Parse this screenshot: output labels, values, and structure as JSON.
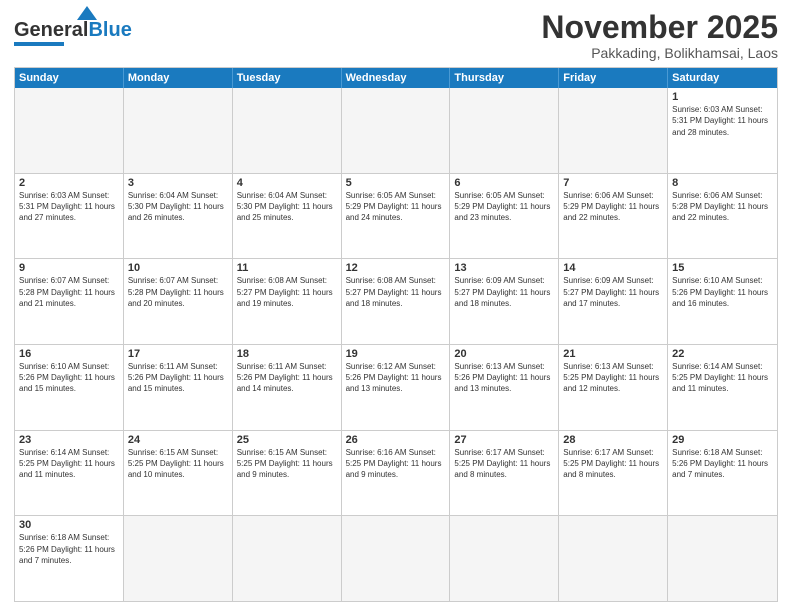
{
  "logo": {
    "text_general": "General",
    "text_blue": "Blue"
  },
  "title": "November 2025",
  "location": "Pakkading, Bolikhamsai, Laos",
  "header": {
    "days": [
      "Sunday",
      "Monday",
      "Tuesday",
      "Wednesday",
      "Thursday",
      "Friday",
      "Saturday"
    ]
  },
  "weeks": [
    [
      {
        "day": "",
        "empty": true,
        "info": ""
      },
      {
        "day": "",
        "empty": true,
        "info": ""
      },
      {
        "day": "",
        "empty": true,
        "info": ""
      },
      {
        "day": "",
        "empty": true,
        "info": ""
      },
      {
        "day": "",
        "empty": true,
        "info": ""
      },
      {
        "day": "",
        "empty": true,
        "info": ""
      },
      {
        "day": "1",
        "empty": false,
        "info": "Sunrise: 6:03 AM\nSunset: 5:31 PM\nDaylight: 11 hours\nand 28 minutes."
      }
    ],
    [
      {
        "day": "2",
        "empty": false,
        "info": "Sunrise: 6:03 AM\nSunset: 5:31 PM\nDaylight: 11 hours\nand 27 minutes."
      },
      {
        "day": "3",
        "empty": false,
        "info": "Sunrise: 6:04 AM\nSunset: 5:30 PM\nDaylight: 11 hours\nand 26 minutes."
      },
      {
        "day": "4",
        "empty": false,
        "info": "Sunrise: 6:04 AM\nSunset: 5:30 PM\nDaylight: 11 hours\nand 25 minutes."
      },
      {
        "day": "5",
        "empty": false,
        "info": "Sunrise: 6:05 AM\nSunset: 5:29 PM\nDaylight: 11 hours\nand 24 minutes."
      },
      {
        "day": "6",
        "empty": false,
        "info": "Sunrise: 6:05 AM\nSunset: 5:29 PM\nDaylight: 11 hours\nand 23 minutes."
      },
      {
        "day": "7",
        "empty": false,
        "info": "Sunrise: 6:06 AM\nSunset: 5:29 PM\nDaylight: 11 hours\nand 22 minutes."
      },
      {
        "day": "8",
        "empty": false,
        "info": "Sunrise: 6:06 AM\nSunset: 5:28 PM\nDaylight: 11 hours\nand 22 minutes."
      }
    ],
    [
      {
        "day": "9",
        "empty": false,
        "info": "Sunrise: 6:07 AM\nSunset: 5:28 PM\nDaylight: 11 hours\nand 21 minutes."
      },
      {
        "day": "10",
        "empty": false,
        "info": "Sunrise: 6:07 AM\nSunset: 5:28 PM\nDaylight: 11 hours\nand 20 minutes."
      },
      {
        "day": "11",
        "empty": false,
        "info": "Sunrise: 6:08 AM\nSunset: 5:27 PM\nDaylight: 11 hours\nand 19 minutes."
      },
      {
        "day": "12",
        "empty": false,
        "info": "Sunrise: 6:08 AM\nSunset: 5:27 PM\nDaylight: 11 hours\nand 18 minutes."
      },
      {
        "day": "13",
        "empty": false,
        "info": "Sunrise: 6:09 AM\nSunset: 5:27 PM\nDaylight: 11 hours\nand 18 minutes."
      },
      {
        "day": "14",
        "empty": false,
        "info": "Sunrise: 6:09 AM\nSunset: 5:27 PM\nDaylight: 11 hours\nand 17 minutes."
      },
      {
        "day": "15",
        "empty": false,
        "info": "Sunrise: 6:10 AM\nSunset: 5:26 PM\nDaylight: 11 hours\nand 16 minutes."
      }
    ],
    [
      {
        "day": "16",
        "empty": false,
        "info": "Sunrise: 6:10 AM\nSunset: 5:26 PM\nDaylight: 11 hours\nand 15 minutes."
      },
      {
        "day": "17",
        "empty": false,
        "info": "Sunrise: 6:11 AM\nSunset: 5:26 PM\nDaylight: 11 hours\nand 15 minutes."
      },
      {
        "day": "18",
        "empty": false,
        "info": "Sunrise: 6:11 AM\nSunset: 5:26 PM\nDaylight: 11 hours\nand 14 minutes."
      },
      {
        "day": "19",
        "empty": false,
        "info": "Sunrise: 6:12 AM\nSunset: 5:26 PM\nDaylight: 11 hours\nand 13 minutes."
      },
      {
        "day": "20",
        "empty": false,
        "info": "Sunrise: 6:13 AM\nSunset: 5:26 PM\nDaylight: 11 hours\nand 13 minutes."
      },
      {
        "day": "21",
        "empty": false,
        "info": "Sunrise: 6:13 AM\nSunset: 5:25 PM\nDaylight: 11 hours\nand 12 minutes."
      },
      {
        "day": "22",
        "empty": false,
        "info": "Sunrise: 6:14 AM\nSunset: 5:25 PM\nDaylight: 11 hours\nand 11 minutes."
      }
    ],
    [
      {
        "day": "23",
        "empty": false,
        "info": "Sunrise: 6:14 AM\nSunset: 5:25 PM\nDaylight: 11 hours\nand 11 minutes."
      },
      {
        "day": "24",
        "empty": false,
        "info": "Sunrise: 6:15 AM\nSunset: 5:25 PM\nDaylight: 11 hours\nand 10 minutes."
      },
      {
        "day": "25",
        "empty": false,
        "info": "Sunrise: 6:15 AM\nSunset: 5:25 PM\nDaylight: 11 hours\nand 9 minutes."
      },
      {
        "day": "26",
        "empty": false,
        "info": "Sunrise: 6:16 AM\nSunset: 5:25 PM\nDaylight: 11 hours\nand 9 minutes."
      },
      {
        "day": "27",
        "empty": false,
        "info": "Sunrise: 6:17 AM\nSunset: 5:25 PM\nDaylight: 11 hours\nand 8 minutes."
      },
      {
        "day": "28",
        "empty": false,
        "info": "Sunrise: 6:17 AM\nSunset: 5:25 PM\nDaylight: 11 hours\nand 8 minutes."
      },
      {
        "day": "29",
        "empty": false,
        "info": "Sunrise: 6:18 AM\nSunset: 5:26 PM\nDaylight: 11 hours\nand 7 minutes."
      }
    ],
    [
      {
        "day": "30",
        "empty": false,
        "info": "Sunrise: 6:18 AM\nSunset: 5:26 PM\nDaylight: 11 hours\nand 7 minutes."
      },
      {
        "day": "",
        "empty": true,
        "info": ""
      },
      {
        "day": "",
        "empty": true,
        "info": ""
      },
      {
        "day": "",
        "empty": true,
        "info": ""
      },
      {
        "day": "",
        "empty": true,
        "info": ""
      },
      {
        "day": "",
        "empty": true,
        "info": ""
      },
      {
        "day": "",
        "empty": true,
        "info": ""
      }
    ]
  ]
}
